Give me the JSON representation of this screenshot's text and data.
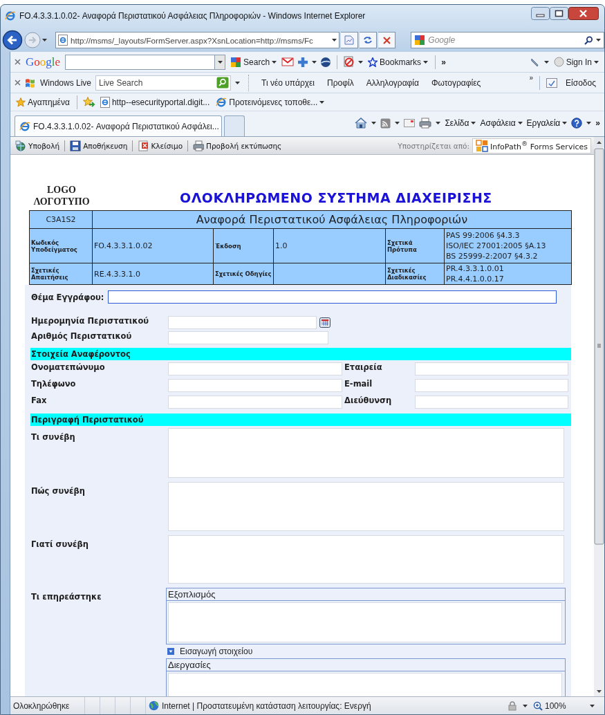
{
  "window": {
    "title": "FO.4.3.3.1.0.02- Αναφορά Περιστατικού Ασφάλειας Πληροφοριών - Windows Internet Explorer"
  },
  "address_bar": {
    "url": "http://msms/_layouts/FormServer.aspx?XsnLocation=http://msms/Fc",
    "search_placeholder": "Google"
  },
  "google_toolbar": {
    "logo": "Google",
    "search_button": "Search",
    "bookmarks": "Bookmarks",
    "more": "»",
    "sign_in": "Sign In"
  },
  "live_toolbar": {
    "brand": "Windows Live",
    "search_placeholder": "Live Search",
    "links": [
      "Τι νέο υπάρχει",
      "Προφίλ",
      "Αλληλογραφία",
      "Φωτογραφίες"
    ],
    "more": "»",
    "sign_in": "Είσοδος"
  },
  "favorites_bar": {
    "label": "Αγαπημένα",
    "items": [
      {
        "label": "http--esecurityportal.digit...",
        "kind": "page"
      },
      {
        "label": "Προτεινόμενες τοποθε...",
        "kind": "menu"
      }
    ]
  },
  "tabs": [
    {
      "label": "FO.4.3.3.1.0.02- Αναφορά Περιστατικού Ασφάλει...",
      "selected": true,
      "kind": "page"
    },
    {
      "selected": false,
      "kind": "new"
    }
  ],
  "command_bar": {
    "menus": [
      "Σελίδα",
      "Ασφάλεια",
      "Εργαλεία"
    ],
    "more": "»"
  },
  "form_toolbar": {
    "buttons": [
      {
        "label": "Υποβολή",
        "kind": "submit"
      },
      {
        "label": "Αποθήκευση",
        "kind": "save"
      },
      {
        "label": "Κλείσιμο",
        "kind": "close"
      },
      {
        "label": "Προβολή εκτύπωσης",
        "kind": "print"
      }
    ],
    "powered_by": "Υποστηρίζεται από:",
    "brand": "InfoPath$^{®}$ Forms Services"
  },
  "form": {
    "logo": [
      "LOGO",
      "ΛΟΓΟΤΥΠΟ"
    ],
    "title": "ΟΛΟΚΛΗΡΩΜΕΝΟ ΣΥΣΤΗΜΑ ΔΙΑΧΕΙΡΙΣΗΣ",
    "header": {
      "code": "C3A1S2",
      "title": "Αναφορά Περιστατικού Ασφάλειας Πληροφοριών",
      "rows": [
        [
          {
            "label": "Κωδικός Υποδείγματος",
            "value": [
              "FO.4.3.3.1.0.02"
            ]
          },
          {
            "label": "Έκδοση",
            "value": [
              "1.0"
            ]
          },
          {
            "label": "Σχετικά Πρότυπα",
            "value": [
              "PAS 99:2006 §4.3.3",
              "ISO/IEC 27001:2005 §A.13",
              "BS 25999-2:2007 §4.3.2"
            ]
          }
        ],
        [
          {
            "label": "Σχετικές Απαιτήσεις",
            "value": [
              "RE.4.3.3.1.0"
            ]
          },
          {
            "label": "Σχετικές Οδηγίες"
          },
          {
            "label": "Σχετικές Διαδικασίες",
            "value": [
              "PR.4.3.3.1.0.01",
              "PR.4.4.1.0.0.17"
            ]
          }
        ]
      ]
    },
    "subject": {
      "label": "Θέμα Εγγράφου:"
    },
    "incident_fields": [
      {
        "label": "Ημερομηνία Περιστατικού",
        "kind": "date"
      },
      {
        "label": "Αριθμός Περιστατικού",
        "kind": "text"
      }
    ],
    "reporter": {
      "title": "Στοιχεία Αναφέροντος",
      "rows": [
        [
          "Ονοματεπώνυμο",
          "Εταιρεία"
        ],
        [
          "Τηλέφωνο",
          "E-mail"
        ],
        [
          "Fax",
          "Διεύθυνση"
        ]
      ]
    },
    "description": {
      "title": "Περιγραφή Περιστατικού",
      "questions": [
        "Τι συνέβη",
        "Πώς συνέβη",
        "Γιατί συνέβη"
      ],
      "affected": {
        "label": "Τι επηρεάστηκε",
        "groups": [
          {
            "title": "Εξοπλισμός",
            "insert_link": "Εισαγωγή στοιχείου"
          },
          {
            "title": "Διεργασίες"
          }
        ]
      }
    }
  },
  "status_bar": {
    "status": "Ολοκληρώθηκε",
    "zone": "Internet | Προστατευμένη κατάσταση λειτουργίας: Ενεργή",
    "zoom": "100%"
  }
}
